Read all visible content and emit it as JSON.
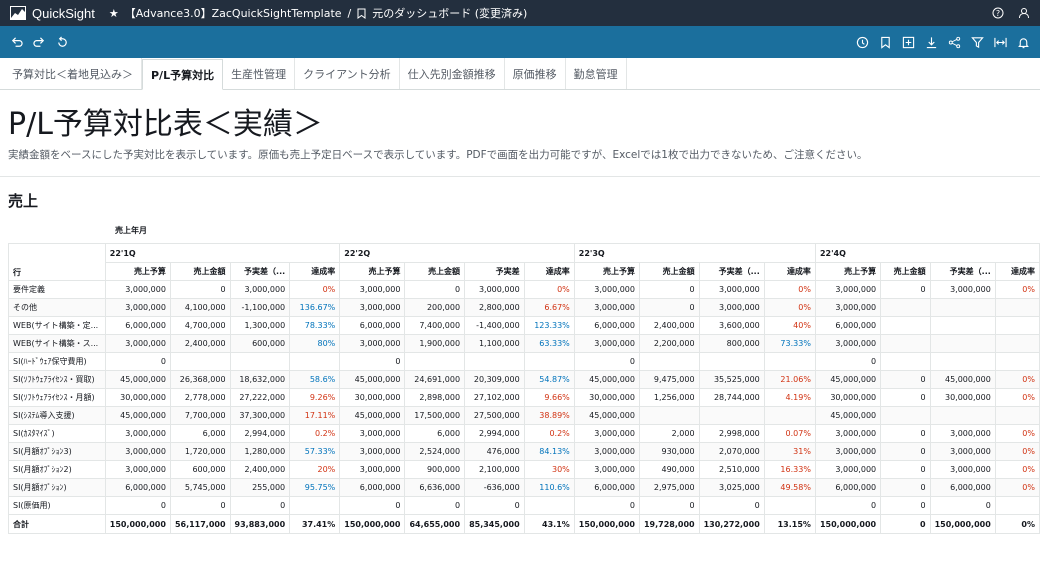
{
  "topbar": {
    "app_name": "QuickSight",
    "breadcrumb_analysis": "【Advance3.0】ZacQuickSightTemplate",
    "breadcrumb_sep": "/",
    "breadcrumb_dashboard": "元のダッシュボード (変更済み)"
  },
  "tabs": [
    {
      "label": "予算対比＜着地見込み＞",
      "active": false
    },
    {
      "label": "P/L予算対比",
      "active": true
    },
    {
      "label": "生産性管理",
      "active": false
    },
    {
      "label": "クライアント分析",
      "active": false
    },
    {
      "label": "仕入先別金額推移",
      "active": false
    },
    {
      "label": "原価推移",
      "active": false
    },
    {
      "label": "勤怠管理",
      "active": false
    }
  ],
  "page": {
    "title": "P/L予算対比表＜実績＞",
    "subtitle": "実績金額をベースにした予実対比を表示しています。原価も売上予定日ベースで表示しています。PDFで画面を出力可能ですが、Excelでは1枚で出力できないため、ご注意ください。",
    "section_title": "売上",
    "field_label": "売上年月"
  },
  "pivot": {
    "row_header": "行",
    "quarters": [
      "22'1Q",
      "22'2Q",
      "22'3Q",
      "22'4Q"
    ],
    "measure_headers": [
      "売上予算",
      "売上金額",
      "予実差（...",
      "達成率"
    ],
    "measure_headers_q2": [
      "売上予算",
      "売上金額",
      "予実差",
      "達成率"
    ],
    "rows": [
      {
        "label": "要件定義",
        "cells": [
          [
            "3,000,000",
            "0",
            "3,000,000",
            "0%"
          ],
          [
            "3,000,000",
            "0",
            "3,000,000",
            "0%"
          ],
          [
            "3,000,000",
            "0",
            "3,000,000",
            "0%"
          ],
          [
            "3,000,000",
            "0",
            "3,000,000",
            "0%"
          ]
        ]
      },
      {
        "label": "その他",
        "cells": [
          [
            "3,000,000",
            "4,100,000",
            "-1,100,000",
            "136.67%"
          ],
          [
            "3,000,000",
            "200,000",
            "2,800,000",
            "6.67%"
          ],
          [
            "3,000,000",
            "0",
            "3,000,000",
            "0%"
          ],
          [
            "3,000,000",
            "",
            "",
            ""
          ]
        ]
      },
      {
        "label": "WEB(サイト構築・定...",
        "cells": [
          [
            "6,000,000",
            "4,700,000",
            "1,300,000",
            "78.33%"
          ],
          [
            "6,000,000",
            "7,400,000",
            "-1,400,000",
            "123.33%"
          ],
          [
            "6,000,000",
            "2,400,000",
            "3,600,000",
            "40%"
          ],
          [
            "6,000,000",
            "",
            "",
            ""
          ]
        ]
      },
      {
        "label": "WEB(サイト構築・ス...",
        "cells": [
          [
            "3,000,000",
            "2,400,000",
            "600,000",
            "80%"
          ],
          [
            "3,000,000",
            "1,900,000",
            "1,100,000",
            "63.33%"
          ],
          [
            "3,000,000",
            "2,200,000",
            "800,000",
            "73.33%"
          ],
          [
            "3,000,000",
            "",
            "",
            ""
          ]
        ]
      },
      {
        "label": "SI(ﾊｰﾄﾞｳｪｱ保守費用)",
        "cells": [
          [
            "0",
            "",
            "",
            ""
          ],
          [
            "0",
            "",
            "",
            ""
          ],
          [
            "0",
            "",
            "",
            ""
          ],
          [
            "0",
            "",
            "",
            ""
          ]
        ]
      },
      {
        "label": "SI(ｿﾌﾄｳｪｱﾗｲｾﾝｽ・買取)",
        "cells": [
          [
            "45,000,000",
            "26,368,000",
            "18,632,000",
            "58.6%"
          ],
          [
            "45,000,000",
            "24,691,000",
            "20,309,000",
            "54.87%"
          ],
          [
            "45,000,000",
            "9,475,000",
            "35,525,000",
            "21.06%"
          ],
          [
            "45,000,000",
            "0",
            "45,000,000",
            "0%"
          ]
        ]
      },
      {
        "label": "SI(ｿﾌﾄｳｪｱﾗｲｾﾝｽ・月額)",
        "cells": [
          [
            "30,000,000",
            "2,778,000",
            "27,222,000",
            "9.26%"
          ],
          [
            "30,000,000",
            "2,898,000",
            "27,102,000",
            "9.66%"
          ],
          [
            "30,000,000",
            "1,256,000",
            "28,744,000",
            "4.19%"
          ],
          [
            "30,000,000",
            "0",
            "30,000,000",
            "0%"
          ]
        ]
      },
      {
        "label": "SI(ｼｽﾃﾑ導入支援)",
        "cells": [
          [
            "45,000,000",
            "7,700,000",
            "37,300,000",
            "17.11%"
          ],
          [
            "45,000,000",
            "17,500,000",
            "27,500,000",
            "38.89%"
          ],
          [
            "45,000,000",
            "",
            "",
            ""
          ],
          [
            "45,000,000",
            "",
            "",
            ""
          ]
        ]
      },
      {
        "label": "SI(ｶｽﾀﾏｲｽﾞ)",
        "cells": [
          [
            "3,000,000",
            "6,000",
            "2,994,000",
            "0.2%"
          ],
          [
            "3,000,000",
            "6,000",
            "2,994,000",
            "0.2%"
          ],
          [
            "3,000,000",
            "2,000",
            "2,998,000",
            "0.07%"
          ],
          [
            "3,000,000",
            "0",
            "3,000,000",
            "0%"
          ]
        ]
      },
      {
        "label": "SI(月額ｵﾌﾟｼｮﾝ3)",
        "cells": [
          [
            "3,000,000",
            "1,720,000",
            "1,280,000",
            "57.33%"
          ],
          [
            "3,000,000",
            "2,524,000",
            "476,000",
            "84.13%"
          ],
          [
            "3,000,000",
            "930,000",
            "2,070,000",
            "31%"
          ],
          [
            "3,000,000",
            "0",
            "3,000,000",
            "0%"
          ]
        ]
      },
      {
        "label": "SI(月額ｵﾌﾟｼｮﾝ2)",
        "cells": [
          [
            "3,000,000",
            "600,000",
            "2,400,000",
            "20%"
          ],
          [
            "3,000,000",
            "900,000",
            "2,100,000",
            "30%"
          ],
          [
            "3,000,000",
            "490,000",
            "2,510,000",
            "16.33%"
          ],
          [
            "3,000,000",
            "0",
            "3,000,000",
            "0%"
          ]
        ]
      },
      {
        "label": "SI(月額ｵﾌﾟｼｮﾝ)",
        "cells": [
          [
            "6,000,000",
            "5,745,000",
            "255,000",
            "95.75%"
          ],
          [
            "6,000,000",
            "6,636,000",
            "-636,000",
            "110.6%"
          ],
          [
            "6,000,000",
            "2,975,000",
            "3,025,000",
            "49.58%"
          ],
          [
            "6,000,000",
            "0",
            "6,000,000",
            "0%"
          ]
        ]
      },
      {
        "label": "SI(原価用)",
        "cells": [
          [
            "0",
            "0",
            "0",
            ""
          ],
          [
            "0",
            "0",
            "0",
            ""
          ],
          [
            "0",
            "0",
            "0",
            ""
          ],
          [
            "0",
            "0",
            "0",
            ""
          ]
        ]
      }
    ],
    "total": {
      "label": "合計",
      "cells": [
        [
          "150,000,000",
          "56,117,000",
          "93,883,000",
          "37.41%"
        ],
        [
          "150,000,000",
          "64,655,000",
          "85,345,000",
          "43.1%"
        ],
        [
          "150,000,000",
          "19,728,000",
          "130,272,000",
          "13.15%"
        ],
        [
          "150,000,000",
          "0",
          "150,000,000",
          "0%"
        ]
      ]
    }
  },
  "colors": {
    "topbar": "#232f3e",
    "toolbar": "#1b6f9d",
    "low_rate": "#d13212",
    "high_rate": "#0073bb"
  },
  "icons": {
    "topbar": [
      "quicksight-logo-icon",
      "star-icon",
      "bookmark-icon",
      "help-icon",
      "user-icon"
    ],
    "toolbar_left": [
      "undo-icon",
      "redo-icon",
      "reset-icon"
    ],
    "toolbar_right": [
      "schedule-icon",
      "bookmark-icon",
      "export-icon",
      "download-icon",
      "share-icon",
      "filter-icon",
      "fit-width-icon",
      "alert-icon"
    ]
  }
}
